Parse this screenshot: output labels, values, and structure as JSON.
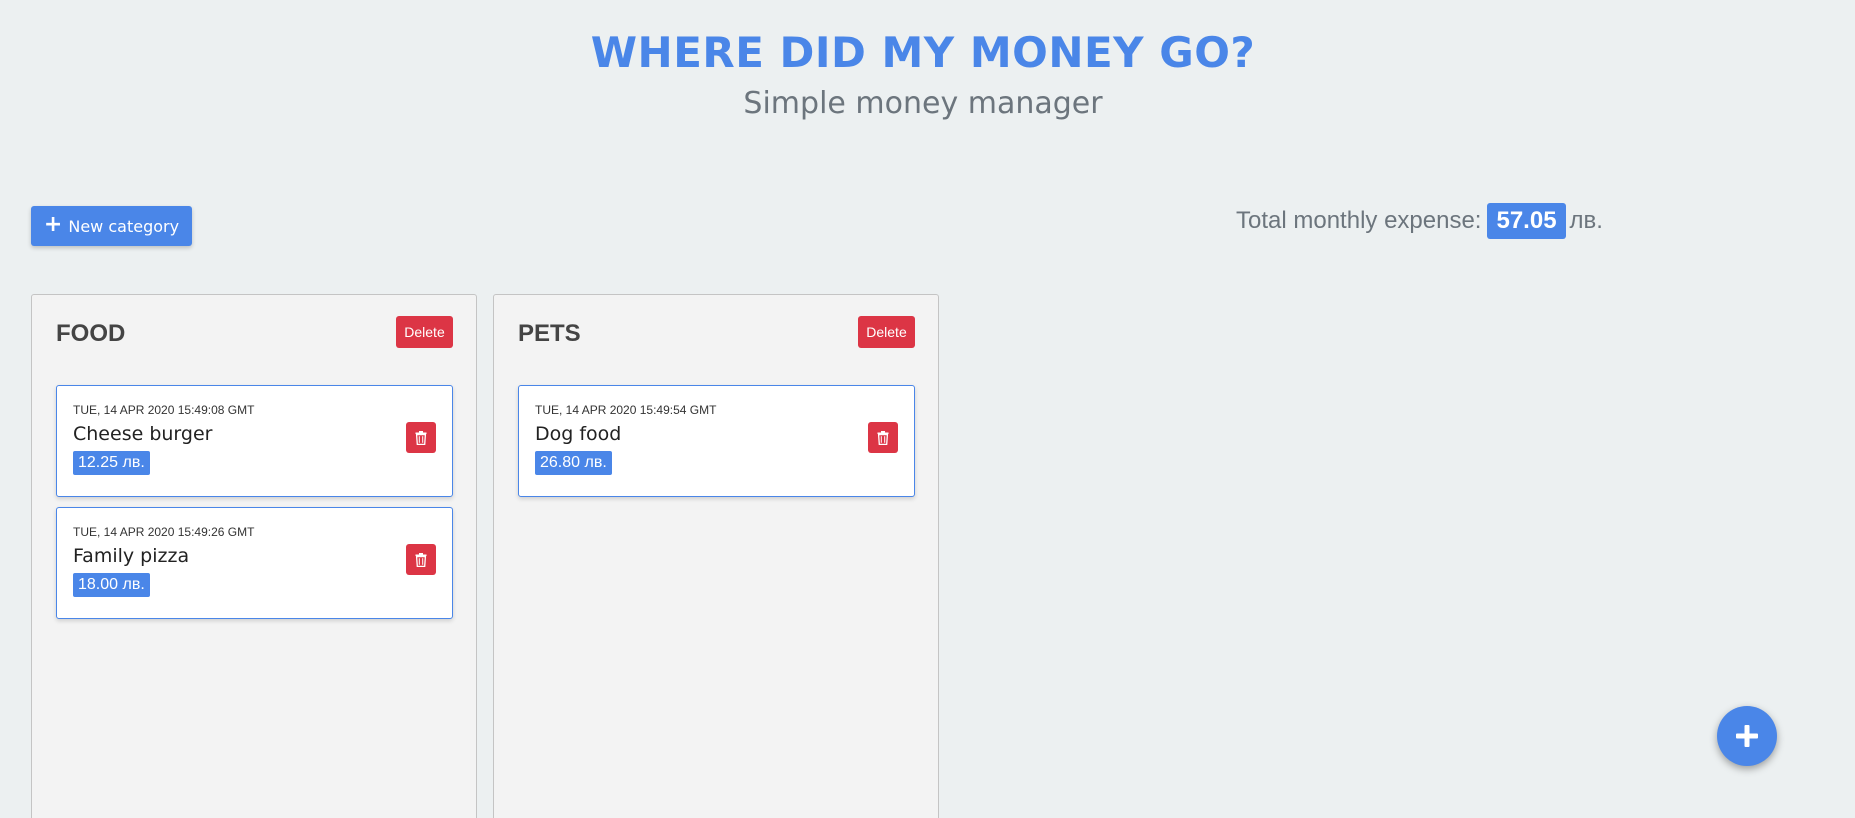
{
  "header": {
    "title": "WHERE DID MY MONEY GO?",
    "subtitle": "Simple money manager"
  },
  "toolbar": {
    "new_category_label": "New category",
    "new_category_icon": "plus-icon"
  },
  "summary": {
    "label": "Total monthly expense:",
    "amount": "57.05",
    "currency": "лв."
  },
  "categories": [
    {
      "name": "FOOD",
      "delete_label": "Delete",
      "expenses": [
        {
          "date": "TUE, 14 APR 2020 15:49:08 GMT",
          "name": "Cheese burger",
          "amount": "12.25 лв."
        },
        {
          "date": "TUE, 14 APR 2020 15:49:26 GMT",
          "name": "Family pizza",
          "amount": "18.00 лв."
        }
      ]
    },
    {
      "name": "PETS",
      "delete_label": "Delete",
      "expenses": [
        {
          "date": "TUE, 14 APR 2020 15:49:54 GMT",
          "name": "Dog food",
          "amount": "26.80 лв."
        }
      ]
    }
  ],
  "fab_icon": "plus-icon",
  "colors": {
    "primary": "#4a86e8",
    "danger": "#dc3545",
    "background": "#ecf0f1"
  }
}
